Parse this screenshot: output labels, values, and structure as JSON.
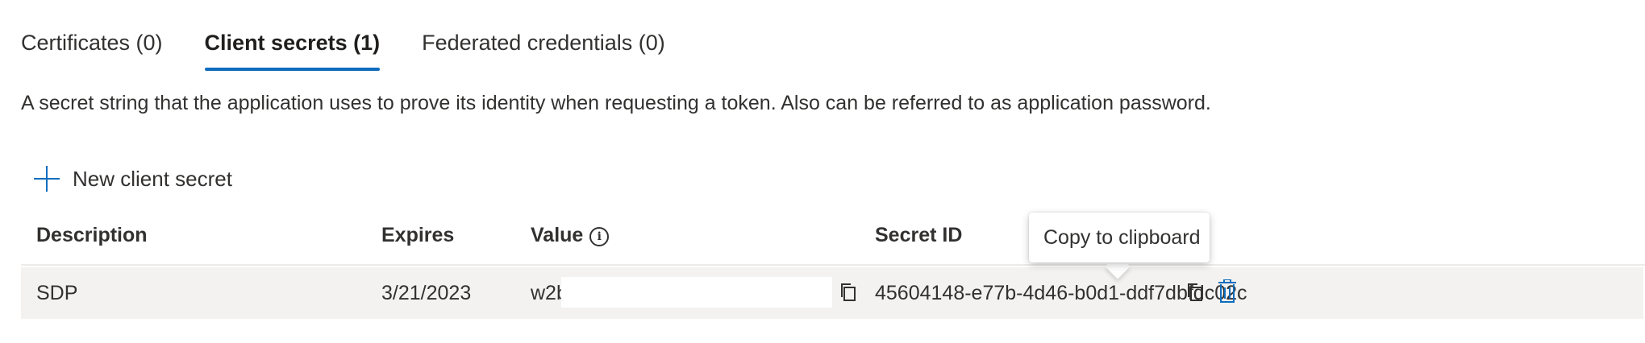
{
  "tabs": [
    {
      "label": "Certificates (0)",
      "active": false
    },
    {
      "label": "Client secrets (1)",
      "active": true
    },
    {
      "label": "Federated credentials (0)",
      "active": false
    }
  ],
  "description": "A secret string that the application uses to prove its identity when requesting a token. Also can be referred to as application password.",
  "toolbar": {
    "new_secret_label": "New client secret",
    "icon": "plus-icon"
  },
  "table": {
    "headers": {
      "description": "Description",
      "expires": "Expires",
      "value": "Value",
      "value_info_icon": "info-icon",
      "secret_id": "Secret ID"
    },
    "rows": [
      {
        "description": "SDP",
        "expires": "3/21/2023",
        "value": "w2b",
        "secret_id": "45604148-e77b-4d46-b0d1-ddf7dbfdc02c"
      }
    ]
  },
  "tooltip": {
    "text": "Copy to clipboard"
  },
  "colors": {
    "accent": "#0f6cbd",
    "row_background": "#f3f2f1",
    "text": "#323130"
  }
}
